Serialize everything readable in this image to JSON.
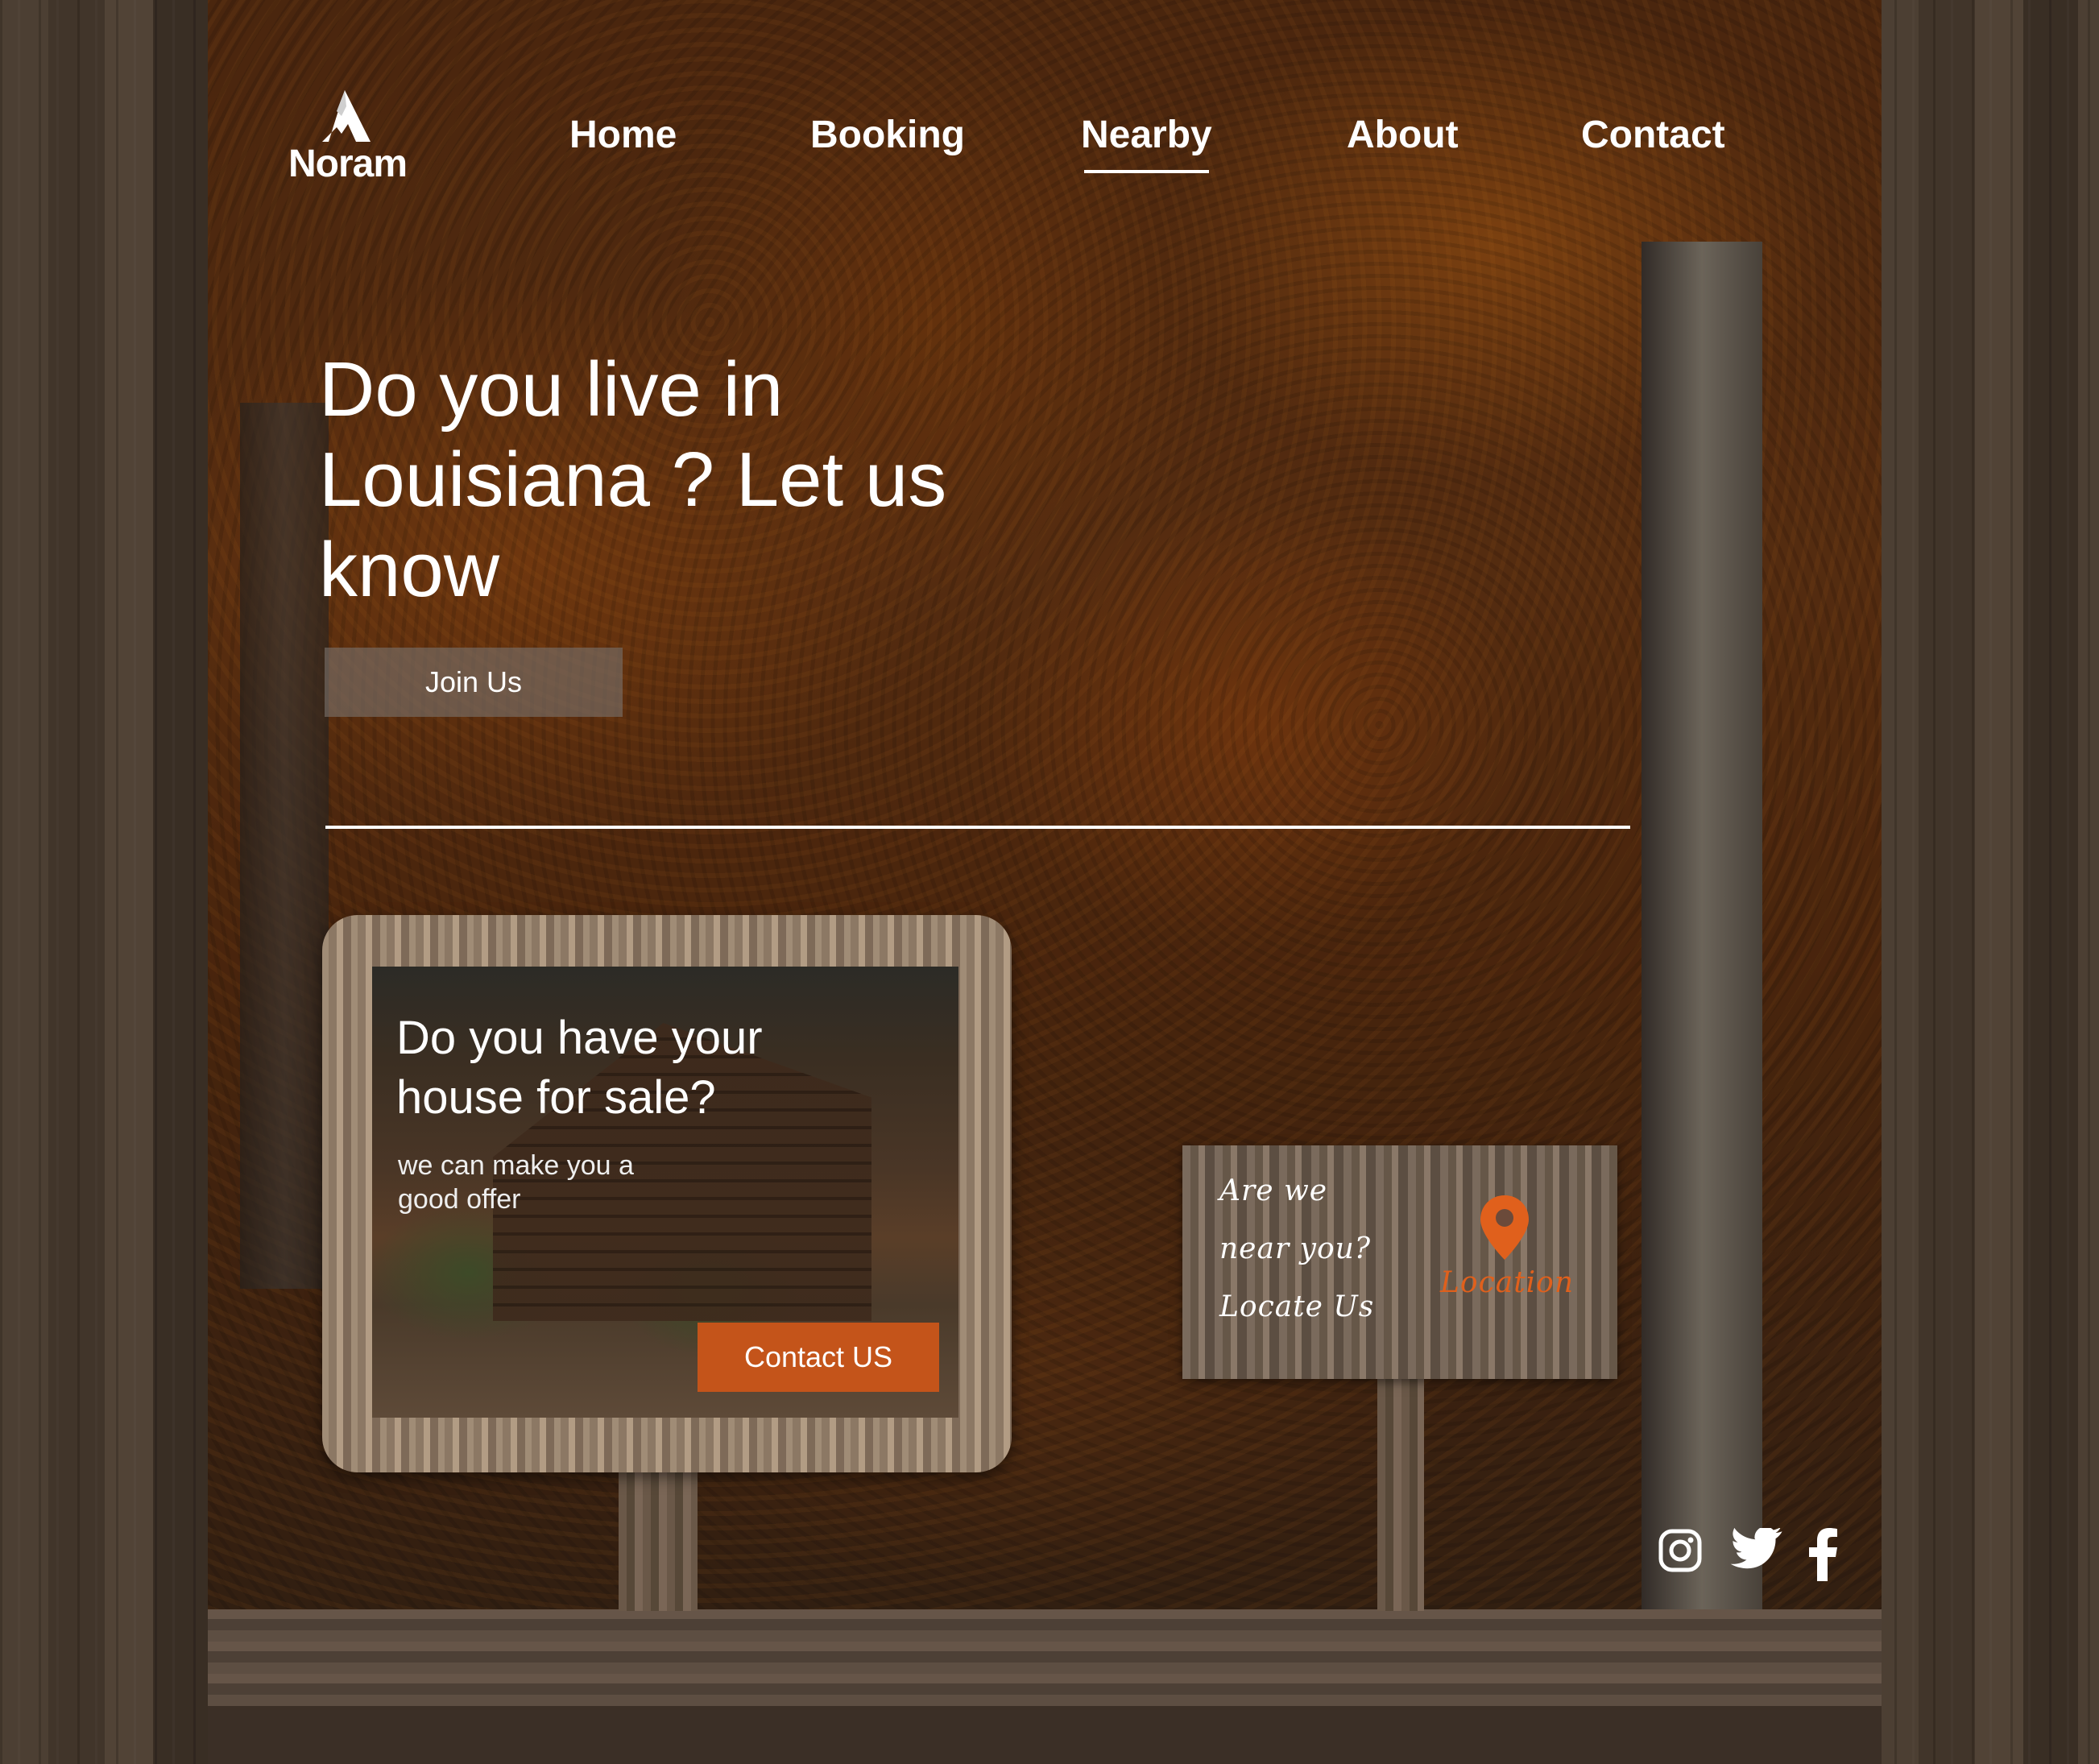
{
  "brand": {
    "name": "Noram"
  },
  "nav": {
    "items": [
      {
        "label": "Home",
        "active": false
      },
      {
        "label": "Booking",
        "active": false
      },
      {
        "label": "Nearby",
        "active": true
      },
      {
        "label": "About",
        "active": false
      },
      {
        "label": "Contact",
        "active": false
      }
    ]
  },
  "hero": {
    "title": "Do you live in Louisiana ? Let us know",
    "join_label": "Join Us"
  },
  "sale_card": {
    "title": "Do you have your house for sale?",
    "subtitle": "we can make you a good offer",
    "contact_label": "Contact US"
  },
  "sign": {
    "lines": [
      "Are we",
      "near you?",
      "Locate Us"
    ],
    "location_label": "Location"
  },
  "social": {
    "icons": [
      "instagram-icon",
      "twitter-icon",
      "facebook-icon"
    ]
  },
  "colors": {
    "accent": "#c4541a",
    "location": "#e0601c",
    "text": "#ffffff"
  }
}
